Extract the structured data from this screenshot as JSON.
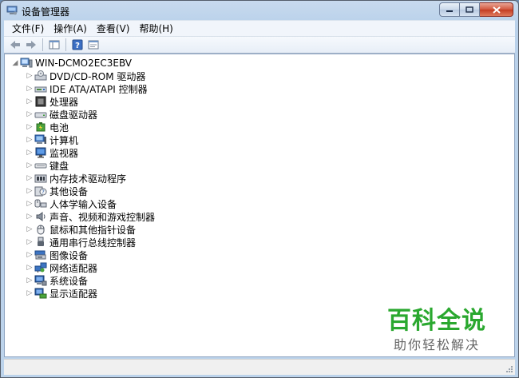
{
  "window": {
    "title": "设备管理器"
  },
  "menubar": {
    "items": [
      "文件(F)",
      "操作(A)",
      "查看(V)",
      "帮助(H)"
    ]
  },
  "tree": {
    "root": "WIN-DCMO2EC3EBV",
    "nodes": [
      {
        "label": "DVD/CD-ROM 驱动器",
        "icon": "dvd-drive-icon"
      },
      {
        "label": "IDE ATA/ATAPI 控制器",
        "icon": "ide-controller-icon"
      },
      {
        "label": "处理器",
        "icon": "processor-icon"
      },
      {
        "label": "磁盘驱动器",
        "icon": "disk-drive-icon"
      },
      {
        "label": "电池",
        "icon": "battery-icon"
      },
      {
        "label": "计算机",
        "icon": "computer-icon"
      },
      {
        "label": "监视器",
        "icon": "monitor-icon"
      },
      {
        "label": "键盘",
        "icon": "keyboard-icon"
      },
      {
        "label": "内存技术驱动程序",
        "icon": "memory-tech-icon"
      },
      {
        "label": "其他设备",
        "icon": "other-devices-icon"
      },
      {
        "label": "人体学输入设备",
        "icon": "hid-icon"
      },
      {
        "label": "声音、视频和游戏控制器",
        "icon": "sound-icon"
      },
      {
        "label": "鼠标和其他指针设备",
        "icon": "mouse-icon"
      },
      {
        "label": "通用串行总线控制器",
        "icon": "usb-icon"
      },
      {
        "label": "图像设备",
        "icon": "imaging-icon"
      },
      {
        "label": "网络适配器",
        "icon": "network-adapter-icon"
      },
      {
        "label": "系统设备",
        "icon": "system-devices-icon"
      },
      {
        "label": "显示适配器",
        "icon": "display-adapter-icon"
      }
    ]
  },
  "watermark": {
    "title": "百科全说",
    "subtitle": "助你轻松解决"
  },
  "colors": {
    "watermark_green": "#2aa82f",
    "close_red": "#c23c22"
  }
}
